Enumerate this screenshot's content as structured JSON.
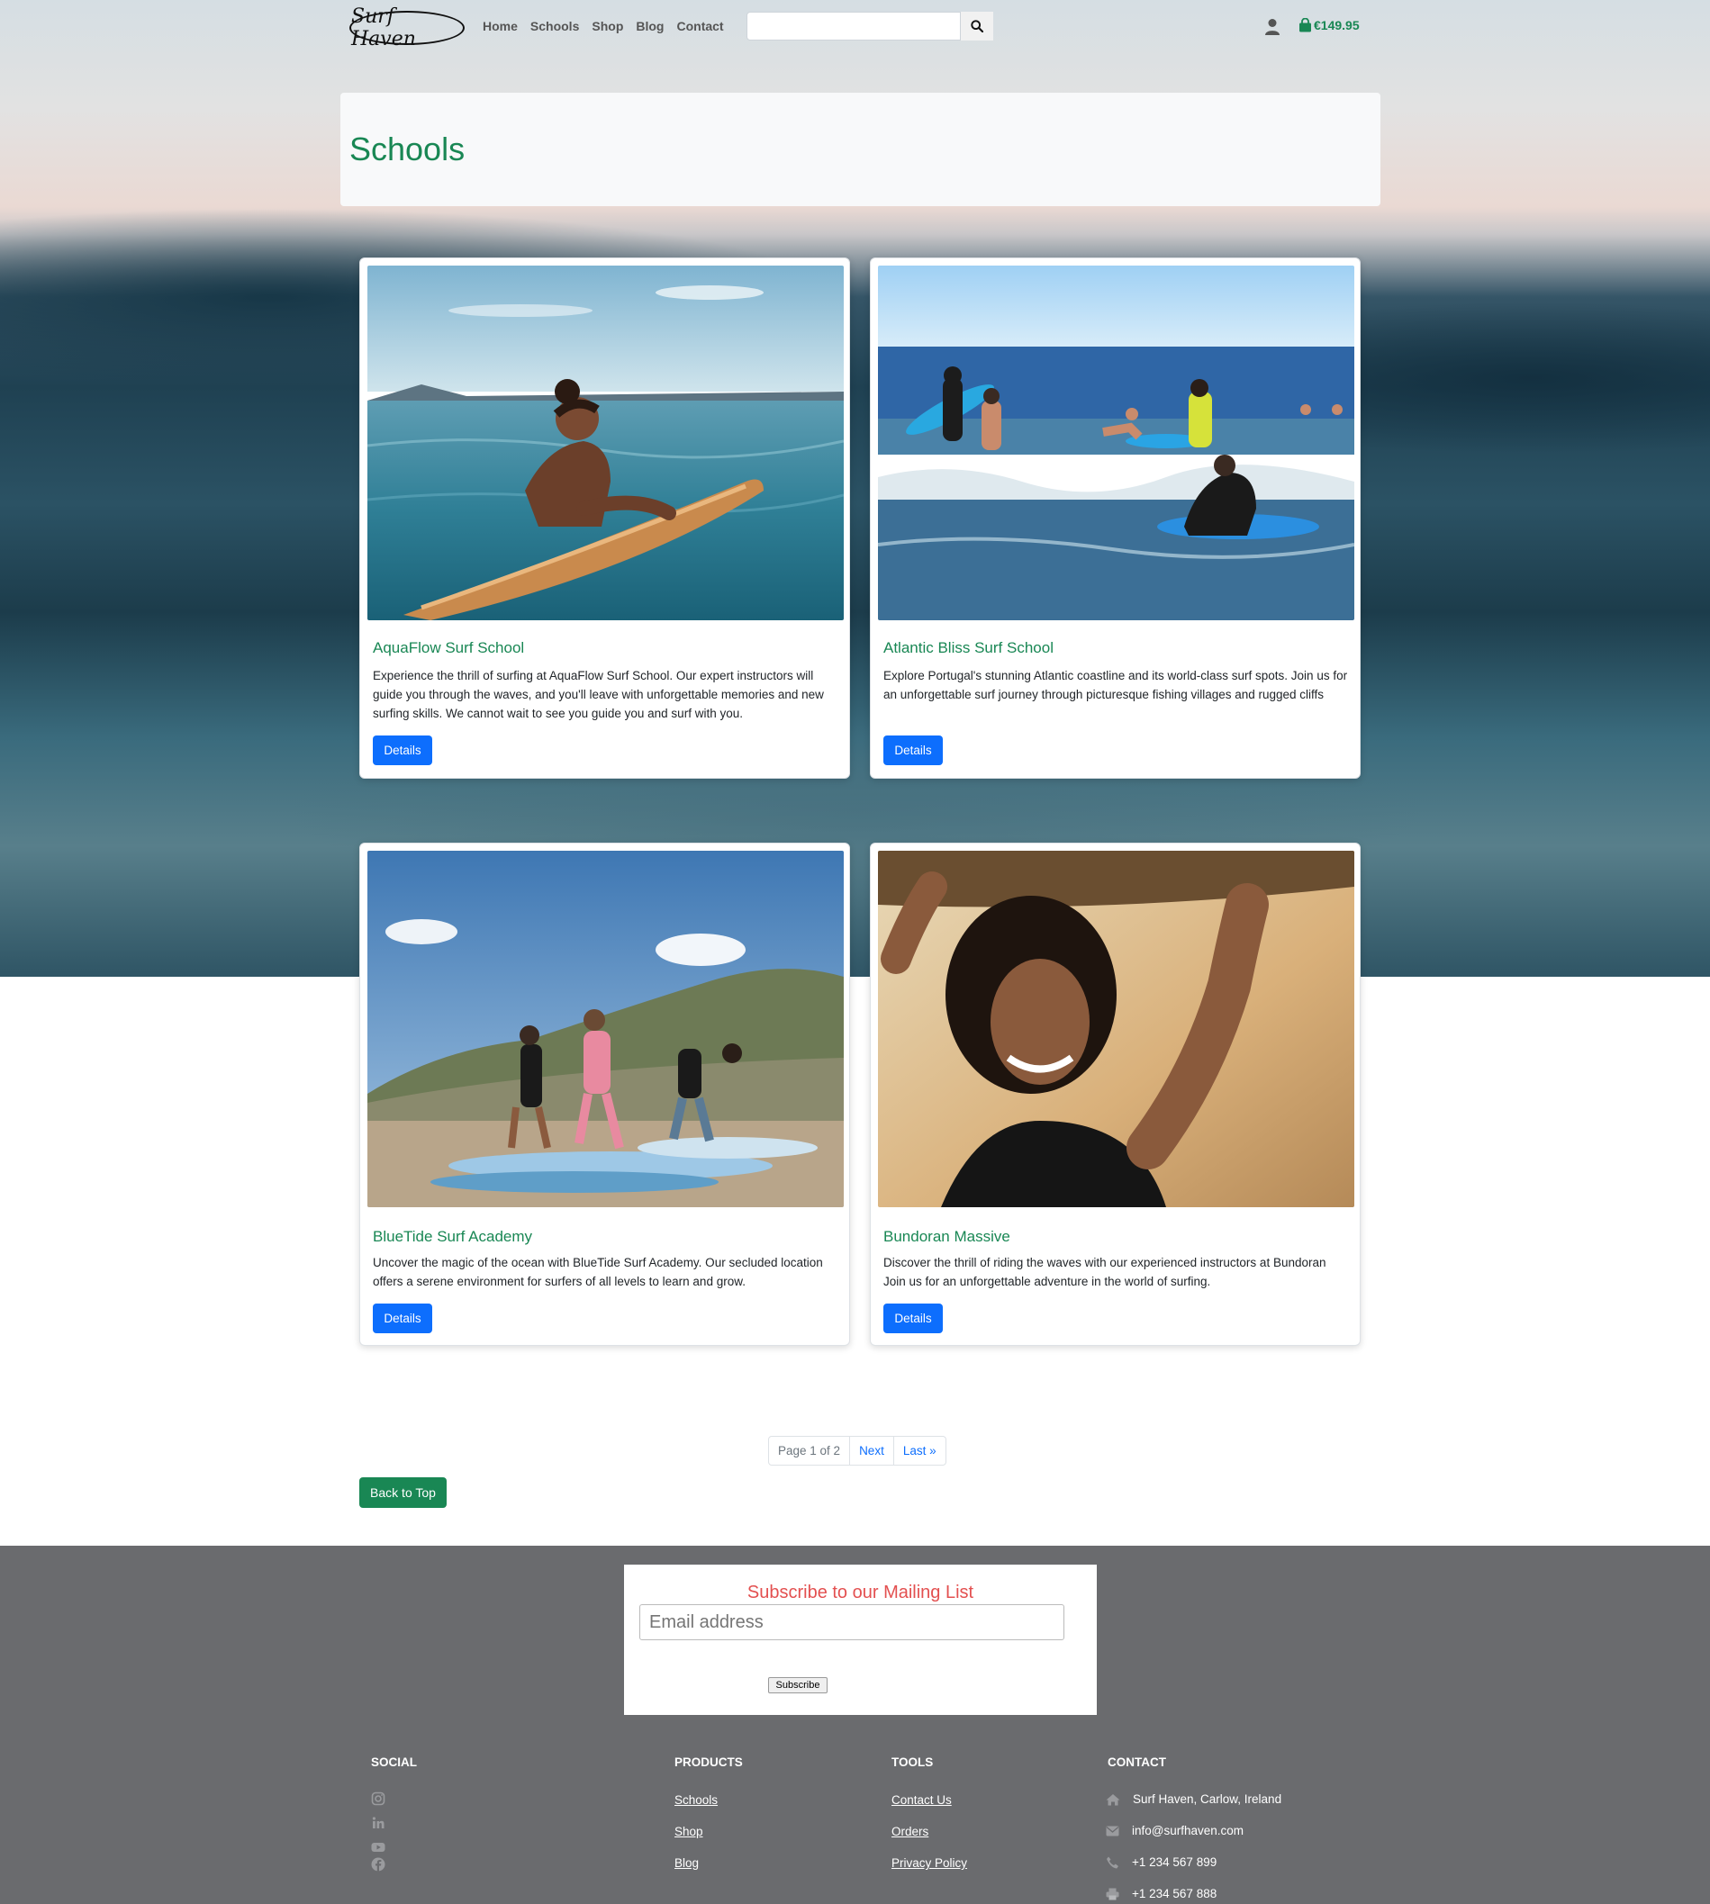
{
  "brand": {
    "logo_text": "Surf Haven"
  },
  "nav": {
    "links": [
      "Home",
      "Schools",
      "Shop",
      "Blog",
      "Contact"
    ],
    "search_placeholder": "",
    "cart_total": "€149.95"
  },
  "page": {
    "title": "Schools"
  },
  "schools": [
    {
      "title": "AquaFlow Surf School",
      "description": "Experience the thrill of surfing at AquaFlow Surf School. Our expert instructors will guide you through the waves, and you'll leave with unforgettable memories and new surfing skills. We cannot wait to see you guide you and surf with you.",
      "button": "Details"
    },
    {
      "title": "Atlantic Bliss Surf School",
      "description": "Explore Portugal's stunning Atlantic coastline and its world-class surf spots. Join us for an unforgettable surf journey through picturesque fishing villages and rugged cliffs",
      "button": "Details"
    },
    {
      "title": "BlueTide Surf Academy",
      "description": "Uncover the magic of the ocean with BlueTide Surf Academy. Our secluded location offers a serene environment for surfers of all levels to learn and grow.",
      "button": "Details"
    },
    {
      "title": "Bundoran Massive",
      "description": "Discover the thrill of riding the waves with our experienced instructors at Bundoran Join us for an unforgettable adventure in the world of surfing.",
      "button": "Details"
    }
  ],
  "pagination": {
    "current": "Page 1 of 2",
    "next": "Next",
    "last": "Last »"
  },
  "back_to_top": "Back to Top",
  "footer": {
    "subscribe_title": "Subscribe to our Mailing List",
    "email_placeholder": "Email address",
    "subscribe_button": "Subscribe",
    "social_heading": "SOCIAL",
    "social_icons": [
      "instagram-icon",
      "linkedin-icon",
      "youtube-icon",
      "facebook-icon"
    ],
    "products_heading": "PRODUCTS",
    "products": [
      "Schools",
      "Shop",
      "Blog"
    ],
    "tools_heading": "TOOLS",
    "tools": [
      "Contact Us",
      "Orders",
      "Privacy Policy"
    ],
    "contact_heading": "CONTACT",
    "contact": {
      "address": "Surf Haven, Carlow, Ireland",
      "email": "info@surfhaven.com",
      "phone": "+1 234 567 899",
      "fax": "+1 234 567 888"
    }
  },
  "colors": {
    "brand_green": "#198754",
    "primary_blue": "#0d6efd",
    "footer_gray": "#6a6b6e",
    "subscribe_red": "#e35050"
  }
}
